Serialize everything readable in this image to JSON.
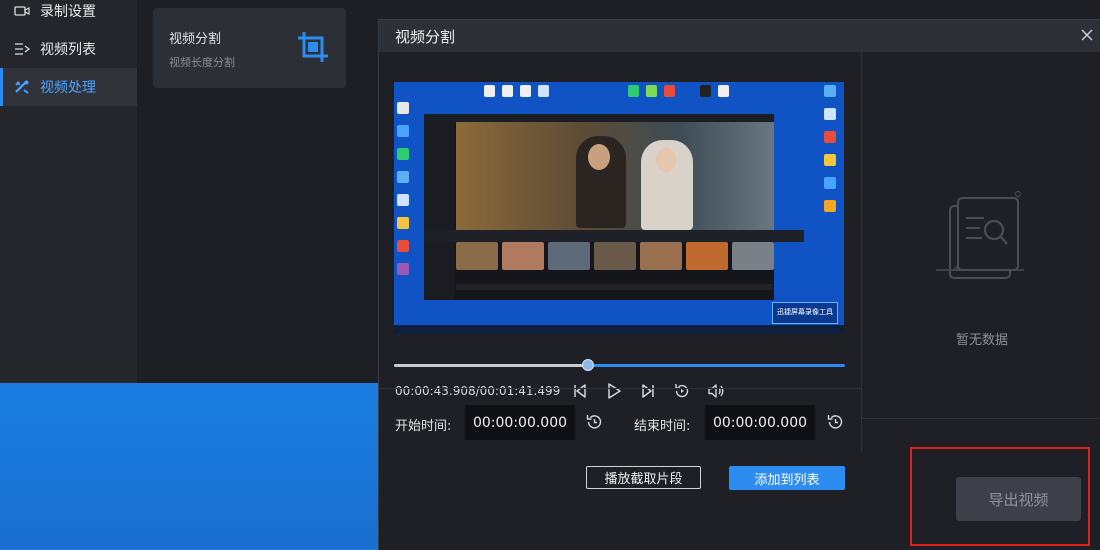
{
  "sidebar": {
    "items": [
      {
        "label": "录制设置",
        "icon": "camera-icon"
      },
      {
        "label": "视频列表",
        "icon": "list-icon"
      },
      {
        "label": "视频处理",
        "icon": "tools-icon"
      }
    ],
    "active_index": 2
  },
  "card": {
    "title": "视频分割",
    "subtitle": "视频长度分割",
    "icon": "crop-icon"
  },
  "dialog": {
    "title": "视频分割",
    "close_icon": "close-icon"
  },
  "player": {
    "current_time": "00:00:43.908",
    "total_time": "00:01:41.499",
    "time_display": "00:00:43.908/00:01:41.499",
    "progress": 0.43,
    "controls": [
      "prev-frame-icon",
      "play-icon",
      "next-frame-icon",
      "replay-icon",
      "volume-icon"
    ]
  },
  "preview_watermark": "迅捷屏幕录像工具",
  "clip": {
    "start_label": "开始时间:",
    "start_value": "00:00:00.000",
    "end_label": "结束时间:",
    "end_value": "00:00:00.000"
  },
  "buttons": {
    "play_clip": "播放截取片段",
    "add_to_list": "添加到列表",
    "export": "导出视频"
  },
  "empty_state": {
    "text": "暂无数据",
    "icon": "empty-document-icon"
  },
  "colors": {
    "accent": "#2d8cf0",
    "highlight_border": "#e02020",
    "dialog_bg": "#1e2026"
  }
}
